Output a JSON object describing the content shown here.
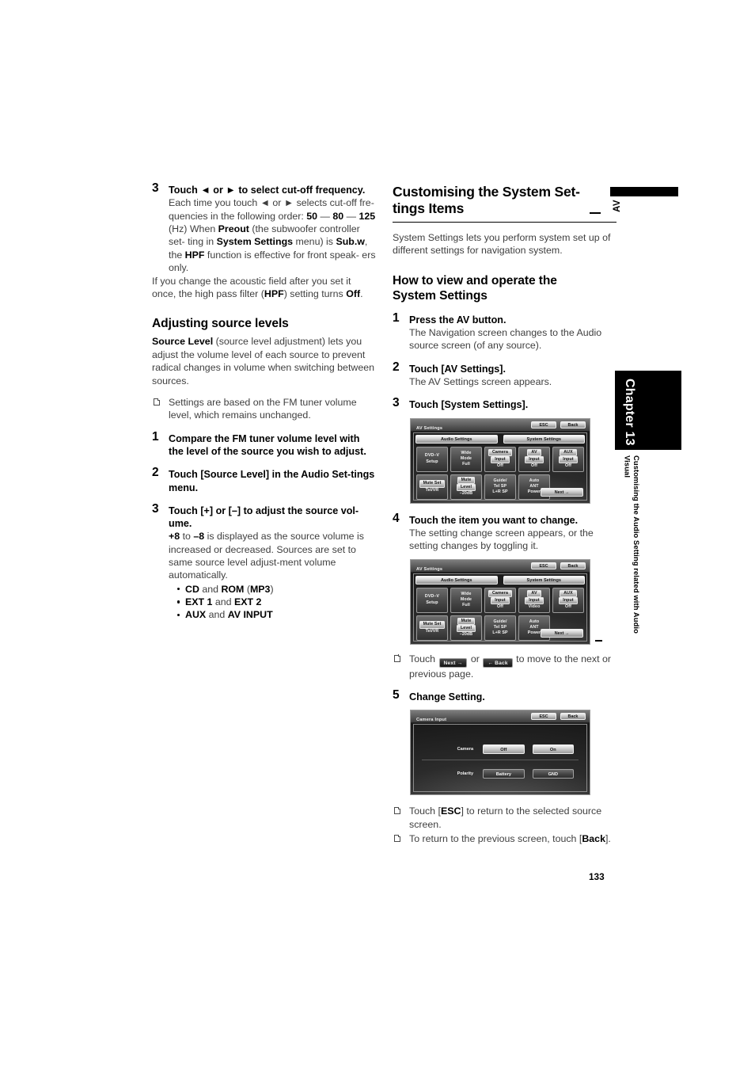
{
  "page": {
    "number": "133",
    "av_marker": "AV",
    "chapter_tab": "Chapter 13",
    "chapter_description": "Customising the Audio Setting related with Audio Visual"
  },
  "left_column": {
    "step3": {
      "num": "3",
      "lead": "Touch ◄ or ► to select cut-off frequency.",
      "line1": "Each time you touch ◄ or ► selects cut-off fre-",
      "line2": "quencies in the following order:",
      "freq_50": "50",
      "dash1": " — ",
      "freq_80": "80",
      "dash2": " — ",
      "freq_125": "125",
      "freq_unit": " (Hz)",
      "when_pre": "When ",
      "preout": "Preout",
      "when_mid": " (the subwoofer controller set-",
      "when_line2_pre": "ting in ",
      "system_settings": "System Settings",
      "when_line2_mid": " menu) is ",
      "subw": "Sub.w",
      "when_line2_end": ",",
      "when_line3_pre": "the ",
      "hpf": "HPF",
      "when_line3_mid": " function is effective for front speak-",
      "when_line4": "ers only.",
      "flow_line1": "If you change the acoustic field after you set it",
      "flow_line2_pre": "once, the high pass filter (",
      "flow_hpf": "HPF",
      "flow_line2_mid": ") setting turns ",
      "flow_off": "Off",
      "flow_line2_end": "."
    },
    "adjusting_heading": "Adjusting source levels",
    "intro": {
      "bold": "Source Level",
      "rest": " (source level adjustment) lets you adjust the volume level of each source to prevent radical changes in volume when switching between sources."
    },
    "note1": "Settings are based on the FM tuner volume level, which remains unchanged.",
    "step1": {
      "num": "1",
      "lead": "Compare the FM tuner volume level with the level of the source you wish to adjust."
    },
    "step2": {
      "num": "2",
      "lead": "Touch [Source Level] in the Audio Set-tings menu."
    },
    "step3b": {
      "num": "3",
      "lead": "Touch [+] or [–] to adjust the source vol-ume.",
      "plus8": "+8",
      "to": " to ",
      "minus8": "–8",
      "body1": " is displayed as the source volume is increased or decreased.",
      "body2": "Sources are set to same source level adjust-ment volume automatically.",
      "bullets": [
        {
          "a": "CD",
          "j": " and ",
          "b": "ROM",
          "c": " (",
          "d": "MP3",
          "e": ")"
        },
        {
          "a": "EXT 1",
          "j": " and ",
          "b": "EXT 2",
          "c": "",
          "d": "",
          "e": ""
        },
        {
          "a": "AUX",
          "j": " and ",
          "b": "AV INPUT",
          "c": "",
          "d": "",
          "e": ""
        }
      ]
    }
  },
  "right_column": {
    "section_title_line1": "Customising the System Set-",
    "section_title_line2": "tings Items",
    "section_intro": "System Settings lets you perform system set up of different settings for navigation system.",
    "howto_heading_line1": "How to view and operate the",
    "howto_heading_line2": "System Settings",
    "step1": {
      "num": "1",
      "lead": "Press the AV button.",
      "body": "The Navigation screen changes to the Audio source screen (of any source)."
    },
    "step2": {
      "num": "2",
      "lead": "Touch [AV Settings].",
      "body": "The AV Settings screen appears."
    },
    "step3": {
      "num": "3",
      "lead": "Touch [System Settings]."
    },
    "step4": {
      "num": "4",
      "lead": "Touch the item you want to change.",
      "body": "The setting change screen appears, or the setting changes by toggling it."
    },
    "note_nav": {
      "pre": "Touch ",
      "next_btn": "Next →",
      "mid": " or ",
      "back_btn": "← Back",
      "post": " to move to the next or previous page."
    },
    "step5": {
      "num": "5",
      "lead": "Change Setting."
    },
    "note_esc": {
      "pre": "Touch [",
      "bold": "ESC",
      "post": "] to return to the selected source screen."
    },
    "note_back": {
      "pre": "To return to the previous screen, touch [",
      "bold": "Back",
      "post": "]."
    }
  },
  "screenshots": {
    "av_settings_1": {
      "title": "AV Settings",
      "esc": "ESC",
      "back": "Back",
      "tabs": [
        "Audio Settings",
        "System Settings"
      ],
      "next": "Next →",
      "cells": [
        {
          "lines": [
            "DVD–V",
            "Setup"
          ],
          "value": ""
        },
        {
          "lines": [
            "Wide",
            "Mode"
          ],
          "value": "Full"
        },
        {
          "lines": [
            "Camera",
            "Input"
          ],
          "value": "Off",
          "hl": 1
        },
        {
          "lines": [
            "AV",
            "Input"
          ],
          "value": "Off",
          "hl": 1
        },
        {
          "lines": [
            "AUX",
            "Input"
          ],
          "value": "Off",
          "hl": 1
        },
        {
          "lines": [
            "Mute Set"
          ],
          "value": "Tel/VR",
          "hl": 0
        },
        {
          "lines": [
            "Mute",
            "Level"
          ],
          "value": "–20dB",
          "hl": 1
        },
        {
          "lines": [
            "Guide/",
            "Tel SP"
          ],
          "value": "L+R SP"
        },
        {
          "lines": [
            "Auto",
            "ANT"
          ],
          "value": "Power"
        },
        {
          "lines": [],
          "value": "",
          "blank": true
        }
      ]
    },
    "av_settings_2": {
      "title": "AV Settings",
      "esc": "ESC",
      "back": "Back",
      "tabs": [
        "Audio Settings",
        "System Settings"
      ],
      "next": "Next →",
      "cells": [
        {
          "lines": [
            "DVD–V",
            "Setup"
          ],
          "value": ""
        },
        {
          "lines": [
            "Wide",
            "Mode"
          ],
          "value": "Full"
        },
        {
          "lines": [
            "Camera",
            "Input"
          ],
          "value": "Off",
          "hl": 1
        },
        {
          "lines": [
            "AV",
            "Input"
          ],
          "value": "Video",
          "hl": 1
        },
        {
          "lines": [
            "AUX",
            "Input"
          ],
          "value": "Off",
          "hl": 1
        },
        {
          "lines": [
            "Mute Set"
          ],
          "value": "Tel/VR",
          "hl": 0
        },
        {
          "lines": [
            "Mute",
            "Level"
          ],
          "value": "–20dB",
          "hl": 1
        },
        {
          "lines": [
            "Guide/",
            "Tel SP"
          ],
          "value": "L+R SP"
        },
        {
          "lines": [
            "Auto",
            "ANT"
          ],
          "value": "Power"
        },
        {
          "lines": [],
          "value": "",
          "blank": true
        }
      ]
    },
    "camera_input": {
      "title": "Camera Input",
      "esc": "ESC",
      "back": "Back",
      "row1_label": "Camera",
      "row1_btn1": "Off",
      "row1_btn2": "On",
      "row2_label": "Polarity",
      "row2_btn1": "Battery",
      "row2_btn2": "GND"
    }
  }
}
